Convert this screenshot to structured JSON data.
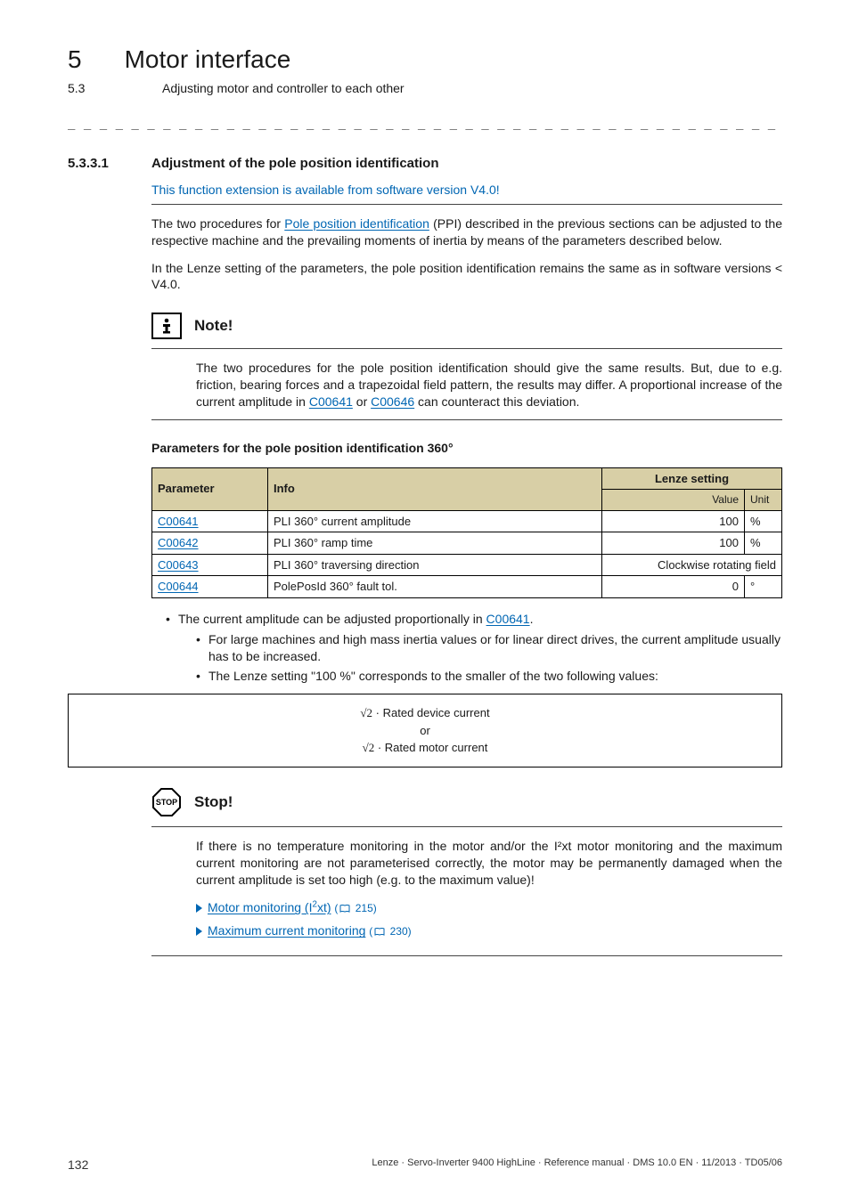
{
  "chapter": {
    "num": "5",
    "title": "Motor interface"
  },
  "subchapter": {
    "num": "5.3",
    "title": "Adjusting motor and controller to each other"
  },
  "separator": "_ _ _ _ _ _ _ _ _ _ _ _ _ _ _ _ _ _ _ _ _ _ _ _ _ _ _ _ _ _ _ _ _ _ _ _ _ _ _ _ _ _ _ _ _ _ _ _ _ _ _ _ _ _ _ _ _ _ _ _ _ _ _ _",
  "section": {
    "num": "5.3.3.1",
    "title": "Adjustment of the pole position identification"
  },
  "version_line": "This function extension is available from software version V4.0!",
  "intro": {
    "pre": "The two procedures for ",
    "link": "Pole position identification",
    "mid": " (PPI) described in the previous sections can be adjusted to the respective machine and the prevailing moments of inertia by means of the parameters described below.",
    "p2": "In the Lenze setting of the parameters, the pole position identification remains the same as in software versions < V4.0."
  },
  "note": {
    "title": "Note!",
    "body_pre": "The two procedures for the pole position identification should give the same results. But, due to e.g. friction, bearing forces and a trapezoidal field pattern, the results may differ. A proportional increase of the current amplitude in ",
    "link1": "C00641",
    "mid": " or ",
    "link2": "C00646",
    "post": " can counteract this deviation."
  },
  "params_heading": "Parameters for the pole position identification 360°",
  "table": {
    "head": {
      "parameter": "Parameter",
      "info": "Info",
      "lenze": "Lenze setting",
      "value": "Value",
      "unit": "Unit"
    },
    "rows": [
      {
        "param": "C00641",
        "info": "PLI 360° current amplitude",
        "value": "100",
        "unit": "%"
      },
      {
        "param": "C00642",
        "info": "PLI 360° ramp time",
        "value": "100",
        "unit": "%"
      },
      {
        "param": "C00643",
        "info": "PLI 360° traversing direction",
        "value": "Clockwise rotating field",
        "unit": ""
      },
      {
        "param": "C00644",
        "info": "PolePosId 360° fault tol.",
        "value": "0",
        "unit": "°"
      }
    ]
  },
  "bullets": {
    "b1_pre": "The current amplitude can be adjusted proportionally in ",
    "b1_link": "C00641",
    "b1_post": ".",
    "sub1": "For large machines and high mass inertia values or for linear direct drives, the current amplitude usually has to be increased.",
    "sub2": "The Lenze setting \"100 %\" corresponds to the smaller of the two following values:"
  },
  "formula": {
    "line1": " · Rated device current",
    "or": "or",
    "line2": " · Rated motor current",
    "sqrt": "√2"
  },
  "stop": {
    "title": "Stop!",
    "body": "If there is no temperature monitoring in the motor and/or the I²xt motor monitoring and the maximum current monitoring are not parameterised correctly, the motor may be permanently damaged when the current amplitude is set too high (e.g. to the maximum value)!",
    "link1_pre": "Motor monitoring (I",
    "link1_sup": "2",
    "link1_post": "xt)",
    "link1_page": "215",
    "link2": "Maximum current monitoring",
    "link2_page": "230"
  },
  "footer": {
    "page": "132",
    "text": "Lenze · Servo-Inverter 9400 HighLine · Reference manual · DMS 10.0 EN · 11/2013 · TD05/06"
  }
}
